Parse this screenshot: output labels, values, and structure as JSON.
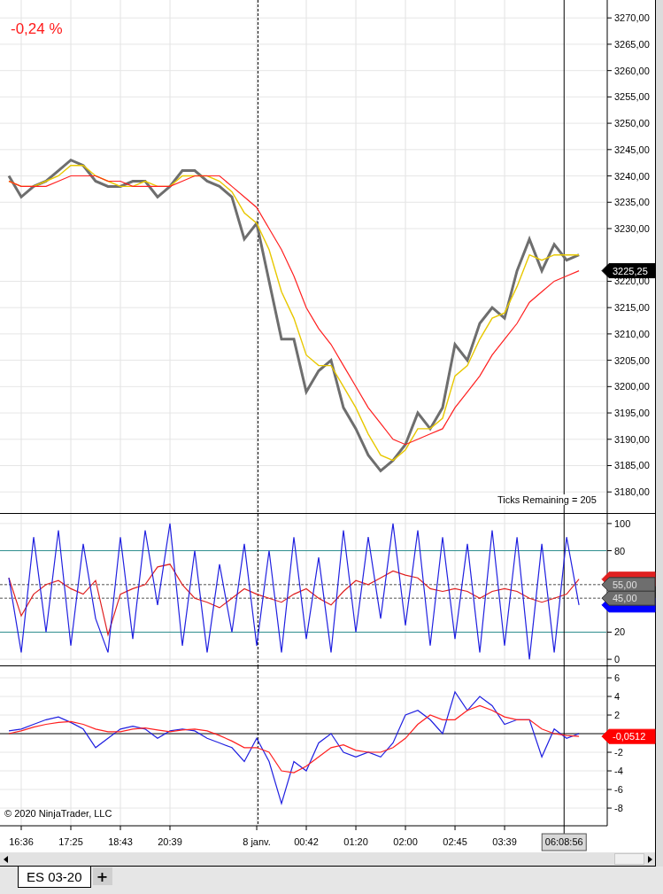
{
  "change_label": "-0,24 %",
  "panels": [
    {
      "note": "Ticks Remaining = 205",
      "last_value_tags": [
        {
          "label": "3225,25",
          "color": "#000000"
        }
      ],
      "chart_data": {
        "type": "line",
        "grid": true,
        "ylim": [
          3176,
          3273.4
        ],
        "yticks": [
          {
            "value": 3180,
            "label": "3180,00"
          },
          {
            "value": 3185,
            "label": "3185,00"
          },
          {
            "value": 3190,
            "label": "3190,00"
          },
          {
            "value": 3195,
            "label": "3195,00"
          },
          {
            "value": 3200,
            "label": "3200,00"
          },
          {
            "value": 3205,
            "label": "3205,00"
          },
          {
            "value": 3210,
            "label": "3210,00"
          },
          {
            "value": 3215,
            "label": "3215,00"
          },
          {
            "value": 3220,
            "label": "3220,00"
          },
          {
            "value": 3230,
            "label": "3230,00"
          },
          {
            "value": 3235,
            "label": "3235,00"
          },
          {
            "value": 3240,
            "label": "3240,00"
          },
          {
            "value": 3245,
            "label": "3245,00"
          },
          {
            "value": 3250,
            "label": "3250,00"
          },
          {
            "value": 3255,
            "label": "3255,00"
          },
          {
            "value": 3260,
            "label": "3260,00"
          },
          {
            "value": 3265,
            "label": "3265,00"
          },
          {
            "value": 3270,
            "label": "3270,00"
          }
        ],
        "series": [
          {
            "color": "#6e6e6e",
            "values": [
              3240,
              3236,
              3238,
              3239,
              3241,
              3243,
              3242,
              3239,
              3238,
              3238,
              3239,
              3239,
              3236,
              3238,
              3241,
              3241,
              3239,
              3238,
              3236,
              3228,
              3231,
              3220,
              3209,
              3209,
              3199,
              3203,
              3205,
              3196,
              3192,
              3187,
              3184,
              3186,
              3189,
              3195,
              3192,
              3196,
              3208,
              3205,
              3212,
              3215,
              3213,
              3222,
              3228,
              3222,
              3227,
              3224,
              3225
            ]
          },
          {
            "color": "#e8c800",
            "values": [
              3239,
              3238,
              3238,
              3239,
              3240,
              3242,
              3242,
              3240,
              3239,
              3238,
              3238,
              3239,
              3238,
              3238,
              3240,
              3240,
              3240,
              3239,
              3237,
              3233,
              3231,
              3226,
              3218,
              3213,
              3206,
              3204,
              3204,
              3200,
              3196,
              3191,
              3187,
              3186,
              3188,
              3192,
              3192,
              3194,
              3202,
              3204,
              3209,
              3213,
              3214,
              3219,
              3225,
              3224,
              3225,
              3225,
              3225
            ]
          },
          {
            "color": "#ff2020",
            "values": [
              3239,
              3238,
              3238,
              3238,
              3239,
              3240,
              3240,
              3240,
              3239,
              3239,
              3238,
              3238,
              3238,
              3238,
              3239,
              3240,
              3240,
              3240,
              3238,
              3236,
              3234,
              3230,
              3226,
              3221,
              3215,
              3211,
              3208,
              3204,
              3200,
              3196,
              3193,
              3190,
              3189,
              3190,
              3191,
              3192,
              3196,
              3199,
              3202,
              3206,
              3209,
              3212,
              3216,
              3218,
              3220,
              3221,
              3222
            ]
          }
        ]
      }
    },
    {
      "last_value_tags": [
        {
          "color": "#e02020"
        },
        {
          "color": "#0000ff"
        }
      ],
      "chart_data": {
        "type": "line",
        "grid": true,
        "ylim": [
          -4.5,
          107.1
        ],
        "yticks": [
          {
            "value": 0,
            "label": "0"
          },
          {
            "value": 20,
            "label": "20"
          },
          {
            "value": 80,
            "label": "80"
          },
          {
            "value": 100,
            "label": "100"
          }
        ],
        "series": [
          {
            "color": "#e02020",
            "values": [
              60,
              32,
              48,
              55,
              58,
              52,
              48,
              58,
              18,
              48,
              52,
              55,
              68,
              70,
              55,
              45,
              42,
              38,
              45,
              52,
              48,
              45,
              42,
              48,
              52,
              45,
              40,
              50,
              58,
              55,
              60,
              65,
              62,
              60,
              52,
              50,
              52,
              50,
              45,
              50,
              52,
              50,
              45,
              42,
              45,
              48,
              59
            ]
          },
          {
            "color": "#2020e0",
            "values": [
              60,
              5,
              90,
              20,
              95,
              10,
              85,
              30,
              5,
              90,
              15,
              95,
              40,
              100,
              10,
              80,
              5,
              70,
              20,
              85,
              10,
              80,
              5,
              90,
              15,
              75,
              5,
              95,
              20,
              90,
              30,
              100,
              25,
              95,
              10,
              90,
              15,
              85,
              5,
              95,
              10,
              90,
              0,
              85,
              5,
              90,
              40
            ]
          }
        ],
        "ref_lines": [
          {
            "axis": "y",
            "value": 80
          },
          {
            "axis": "y",
            "value": 20
          },
          {
            "axis": "y",
            "value": 55,
            "label": "55,00"
          },
          {
            "axis": "y",
            "value": 45,
            "label": "45,00"
          }
        ]
      }
    },
    {
      "copyright": "© 2020 NinjaTrader, LLC",
      "last_value_tags": [
        {
          "label": "-0,0512",
          "color": "#ff0000"
        }
      ],
      "chart_data": {
        "type": "line",
        "grid": true,
        "ylim": [
          -9.9,
          7.24
        ],
        "categories": [
          null,
          "16:36",
          null,
          null,
          null,
          "17:25",
          null,
          null,
          null,
          "18:43",
          null,
          null,
          null,
          "20:39",
          null,
          null,
          null,
          null,
          null,
          null,
          "8 janv.",
          null,
          null,
          null,
          "00:42",
          null,
          null,
          null,
          "01:20",
          null,
          null,
          null,
          "02:00",
          null,
          null,
          null,
          "02:45",
          null,
          null,
          null,
          "03:39",
          null,
          null,
          null,
          null,
          null,
          null
        ],
        "yticks": [
          {
            "value": -8,
            "label": "-8"
          },
          {
            "value": -6,
            "label": "-6"
          },
          {
            "value": -4,
            "label": "-4"
          },
          {
            "value": -2,
            "label": "-2"
          },
          {
            "value": 2,
            "label": "2"
          },
          {
            "value": 4,
            "label": "4"
          },
          {
            "value": 6,
            "label": "6"
          }
        ],
        "series": [
          {
            "color": "#2020e0",
            "values": [
              0.3,
              0.5,
              1,
              1.5,
              1.8,
              1.2,
              0.5,
              -1.5,
              -0.5,
              0.5,
              0.8,
              0.5,
              -0.5,
              0.3,
              0.5,
              0.3,
              -0.5,
              -1,
              -1.5,
              -3,
              -0.5,
              -3,
              -7.5,
              -3,
              -4,
              -1,
              0,
              -2,
              -2.5,
              -2,
              -2.5,
              -1,
              2,
              2.5,
              1.5,
              0,
              4.5,
              2.5,
              4,
              3,
              1,
              1.5,
              1.5,
              -2.5,
              0.5,
              -0.5,
              0
            ]
          },
          {
            "color": "#ff2020",
            "values": [
              0,
              0.3,
              0.7,
              1,
              1.2,
              1.3,
              1,
              0.5,
              0.2,
              0.2,
              0.5,
              0.6,
              0.4,
              0.2,
              0.4,
              0.5,
              0.3,
              -0.2,
              -0.8,
              -1.5,
              -1.5,
              -2,
              -4,
              -4.2,
              -3.5,
              -2.5,
              -1.5,
              -1.2,
              -1.8,
              -2,
              -2,
              -1.5,
              -0.5,
              1,
              2,
              1.5,
              1.5,
              2.5,
              3,
              2.5,
              1.8,
              1.5,
              1.5,
              0.5,
              0,
              -0.2,
              -0.3
            ]
          }
        ],
        "ref_lines": [
          {
            "axis": "y",
            "value": 0
          }
        ]
      }
    }
  ],
  "cursor_time_label": "06:08:56",
  "tabs": [
    {
      "label": "ES 03-20",
      "selected": true
    }
  ],
  "add_tab": {
    "label": "+"
  }
}
